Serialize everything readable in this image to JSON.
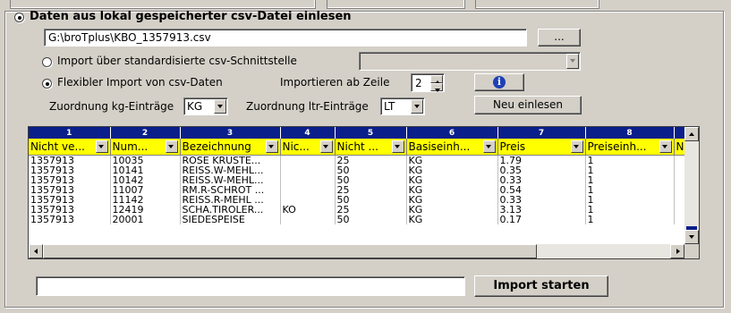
{
  "top_section": {
    "radio_label": "Daten aus lokal gespeicherter csv-Datei einlesen",
    "file_path": "G:\\broTplus\\KBO_1357913.csv",
    "browse_label": "...",
    "import_std_label": "Import über standardisierte csv-Schnittstelle",
    "import_flex_label": "Flexibler Import von csv-Daten",
    "import_ab_zeile_label": "Importieren ab Zeile",
    "import_ab_zeile_value": "2",
    "zuordnung_kg_label": "Zuordnung kg-Einträge",
    "zuordnung_kg_value": "KG",
    "zuordnung_ltr_label": "Zuordnung ltr-Einträge",
    "zuordnung_ltr_value": "LT",
    "neu_einlesen_label": "Neu einlesen",
    "info_icon_glyph": "i"
  },
  "grid": {
    "col_numbers": [
      "1",
      "2",
      "3",
      "4",
      "5",
      "6",
      "7",
      "8"
    ],
    "headers": [
      "Nicht ve...",
      "Num...",
      "Bezeichnung",
      "Nic...",
      "Nicht ...",
      "Basiseinh...",
      "Preis",
      "Preiseinh..."
    ],
    "extra_header": "N",
    "rows": [
      [
        "1357913",
        "10035",
        "ROSE KRUSTE...",
        "",
        "25",
        "KG",
        "1.79",
        "1"
      ],
      [
        "1357913",
        "10141",
        "REISS.W-MEHL...",
        "",
        "50",
        "KG",
        "0.35",
        "1"
      ],
      [
        "1357913",
        "10142",
        "REISS.W-MEHL...",
        "",
        "50",
        "KG",
        "0.33",
        "1"
      ],
      [
        "1357913",
        "11007",
        "RM.R-SCHROT ...",
        "",
        "25",
        "KG",
        "0.54",
        "1"
      ],
      [
        "1357913",
        "11142",
        "REISS.R-MEHL ...",
        "",
        "50",
        "KG",
        "0.33",
        "1"
      ],
      [
        "1357913",
        "12419",
        "SCHA.TIROLER...",
        "KO",
        "25",
        "KG",
        "3.13",
        "1"
      ],
      [
        "1357913",
        "20001",
        "SIEDESPEISE",
        "",
        "50",
        "KG",
        "0.17",
        "1"
      ]
    ]
  },
  "footer": {
    "import_button_label": "Import starten"
  }
}
